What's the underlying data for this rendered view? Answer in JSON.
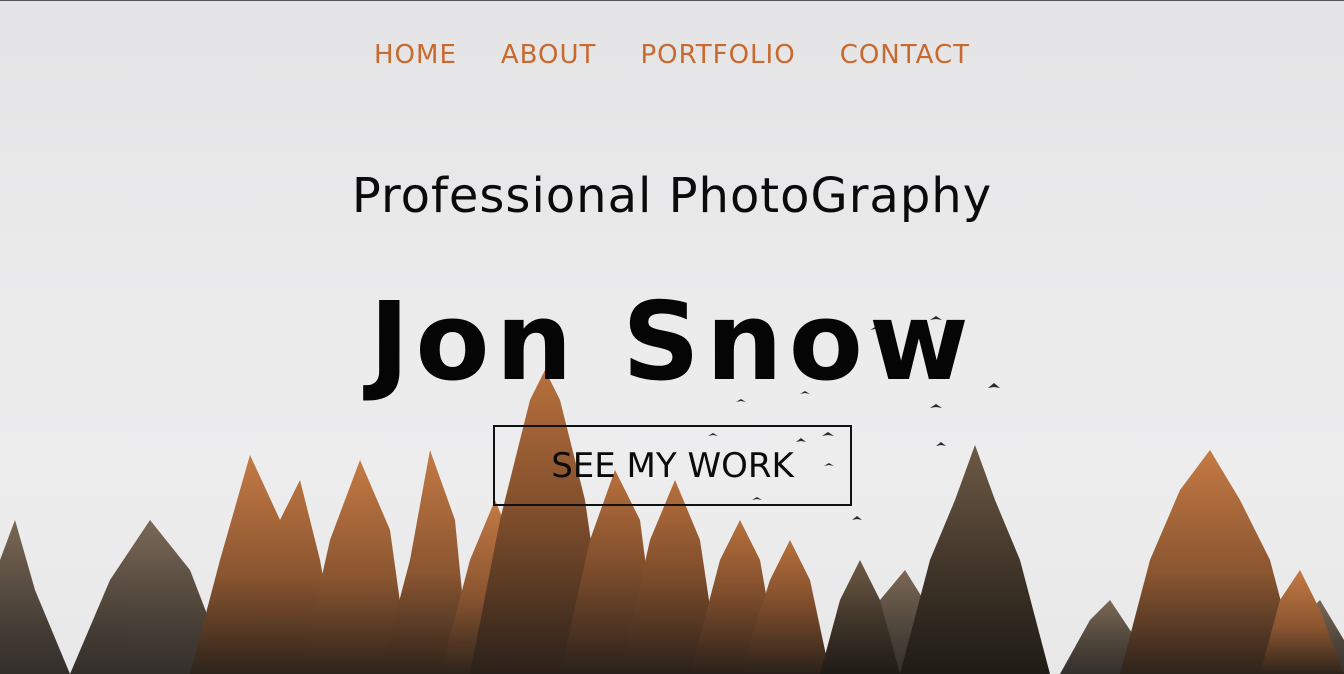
{
  "nav": {
    "items": [
      {
        "label": "HOME"
      },
      {
        "label": "ABOUT"
      },
      {
        "label": "PORTFOLIO"
      },
      {
        "label": "CONTACT"
      }
    ]
  },
  "hero": {
    "subtitle": "Professional PhotoGraphy",
    "title": "Jon Snow",
    "cta_label": "SEE MY WORK"
  },
  "colors": {
    "nav_text": "#c8692e",
    "heading_text": "#050505",
    "sky": "#ebebec",
    "tree_light": "#b86a35",
    "tree_dark": "#3a2d1f"
  }
}
